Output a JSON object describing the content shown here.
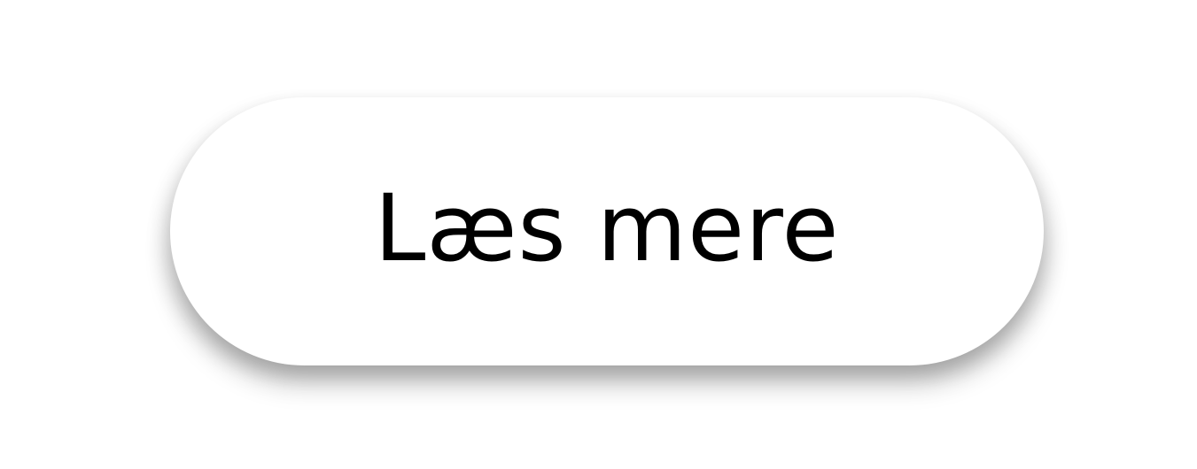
{
  "button": {
    "label": "Læs mere"
  },
  "colors": {
    "page_background": "#ffffff",
    "button_background": "#ffffff",
    "text": "#000000"
  }
}
